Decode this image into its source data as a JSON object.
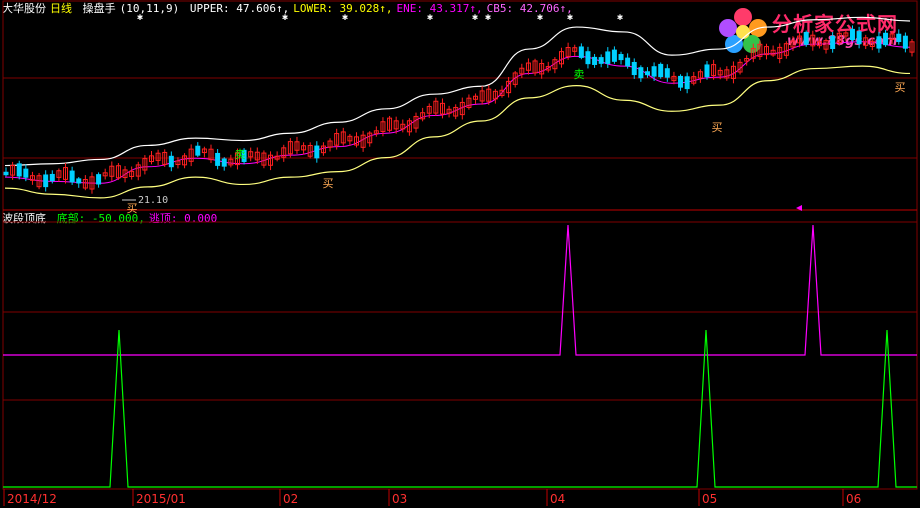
{
  "stock_name": "大华股份",
  "period": "日线",
  "main_indicator": {
    "name": "操盘手",
    "params": "(10,11,9)",
    "values": [
      {
        "label": "UPPER:",
        "value": "47.606↑,",
        "color": "#ffffff"
      },
      {
        "label": "LOWER:",
        "value": "39.028↑,",
        "color": "#ffff00"
      },
      {
        "label": "ENE:",
        "value": "43.317↑,",
        "color": "#ff00ff"
      },
      {
        "label": "CB5:",
        "value": "42.706↑,",
        "color": "#ff66ff"
      }
    ]
  },
  "sub_indicator": {
    "name": "波段顶底",
    "values": [
      {
        "label": "底部:",
        "value": "-50.000,",
        "color": "#00ff00"
      },
      {
        "label": "逃顶:",
        "value": "0.000",
        "color": "#ff00ff"
      }
    ]
  },
  "annotations": {
    "low_price": "21.10",
    "buy_label": "买",
    "sell_label": "卖"
  },
  "x_axis": [
    "2014/12",
    "2015/01",
    "02",
    "03",
    "04",
    "05",
    "06"
  ],
  "logo": {
    "title": "分析家公式网",
    "url": "www.88gs.com"
  },
  "colors": {
    "up": "#ff2020",
    "down": "#00d0ff",
    "upper": "#ffffff",
    "lower": "#ffff80",
    "ene": "#ff00ff",
    "bottom_signal": "#00ff00",
    "top_signal": "#ff00ff",
    "grid": "#800000",
    "background": "#000000"
  },
  "chart_data": {
    "type": "line",
    "x": [
      "2014/12",
      "2015/01",
      "02",
      "03",
      "04",
      "05",
      "06"
    ],
    "series": [
      {
        "name": "底部",
        "values": [
          -50,
          0,
          -50,
          -50,
          -50,
          0,
          -50,
          -50,
          -50
        ]
      },
      {
        "name": "逃顶",
        "values": [
          0,
          0,
          0,
          50,
          0,
          0,
          0,
          50,
          0
        ]
      }
    ],
    "price_series": {
      "upper": [
        26.5,
        26.8,
        27.5,
        29.8,
        31.0,
        30.6,
        31.8,
        33.6,
        35.8,
        38.2,
        39.5,
        45.6,
        49.2,
        48.4,
        44.6,
        45.6,
        49.2,
        50.4,
        50.8,
        50.2
      ],
      "lower": [
        22.8,
        21.8,
        21.2,
        23.0,
        24.6,
        23.4,
        24.6,
        25.5,
        27.8,
        31.2,
        33.8,
        37.6,
        39.6,
        37.2,
        35.4,
        36.4,
        40.4,
        42.4,
        42.8,
        41.6
      ],
      "ene": [
        24.6,
        23.9,
        23.6,
        26.3,
        27.7,
        26.8,
        28.2,
        29.6,
        31.8,
        34.7,
        36.6,
        41.6,
        44.4,
        42.8,
        40.0,
        41.0,
        44.8,
        46.4,
        46.8,
        45.9
      ]
    },
    "buy_signals": [
      "2014/12",
      "03",
      "05",
      "06"
    ],
    "sell_signals": [
      "2015/01",
      "04"
    ]
  }
}
